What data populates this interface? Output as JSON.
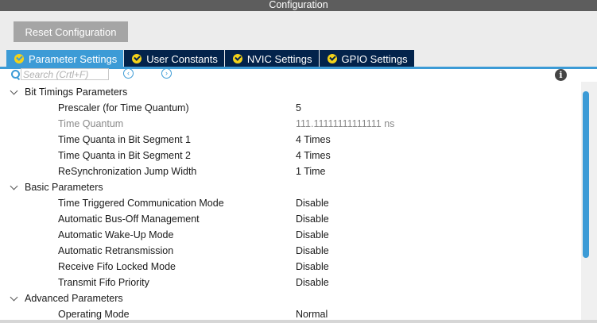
{
  "window": {
    "title": "Configuration"
  },
  "toolbar": {
    "reset_label": "Reset Configuration"
  },
  "tabs": [
    {
      "label": "Parameter Settings",
      "active": true
    },
    {
      "label": "User Constants",
      "active": false
    },
    {
      "label": "NVIC Settings",
      "active": false
    },
    {
      "label": "GPIO Settings",
      "active": false
    }
  ],
  "search": {
    "placeholder": "Search (Crtl+F)",
    "prev_icon": "‹",
    "next_icon": "›"
  },
  "groups": {
    "bit_timings": {
      "title": "Bit Timings Parameters",
      "params": [
        {
          "name": "Prescaler (for Time Quantum)",
          "value": "5"
        },
        {
          "name": "Time Quantum",
          "value": "111.11111111111111 ns"
        },
        {
          "name": "Time Quanta in Bit Segment 1",
          "value": "4 Times"
        },
        {
          "name": "Time Quanta in Bit Segment 2",
          "value": "4 Times"
        },
        {
          "name": "ReSynchronization Jump Width",
          "value": "1 Time"
        }
      ]
    },
    "basic": {
      "title": "Basic Parameters",
      "params": [
        {
          "name": "Time Triggered Communication Mode",
          "value": "Disable"
        },
        {
          "name": "Automatic Bus-Off Management",
          "value": "Disable"
        },
        {
          "name": "Automatic Wake-Up Mode",
          "value": "Disable"
        },
        {
          "name": "Automatic Retransmission",
          "value": "Disable"
        },
        {
          "name": "Receive Fifo Locked Mode",
          "value": "Disable"
        },
        {
          "name": "Transmit Fifo Priority",
          "value": "Disable"
        }
      ]
    },
    "advanced": {
      "title": "Advanced Parameters",
      "params": [
        {
          "name": "Operating Mode",
          "value": "Normal"
        }
      ]
    }
  },
  "colors": {
    "accent": "#3c9bd6",
    "tab_dark": "#03234b",
    "check": "#f2d21a",
    "header": "#5d5d5d"
  }
}
